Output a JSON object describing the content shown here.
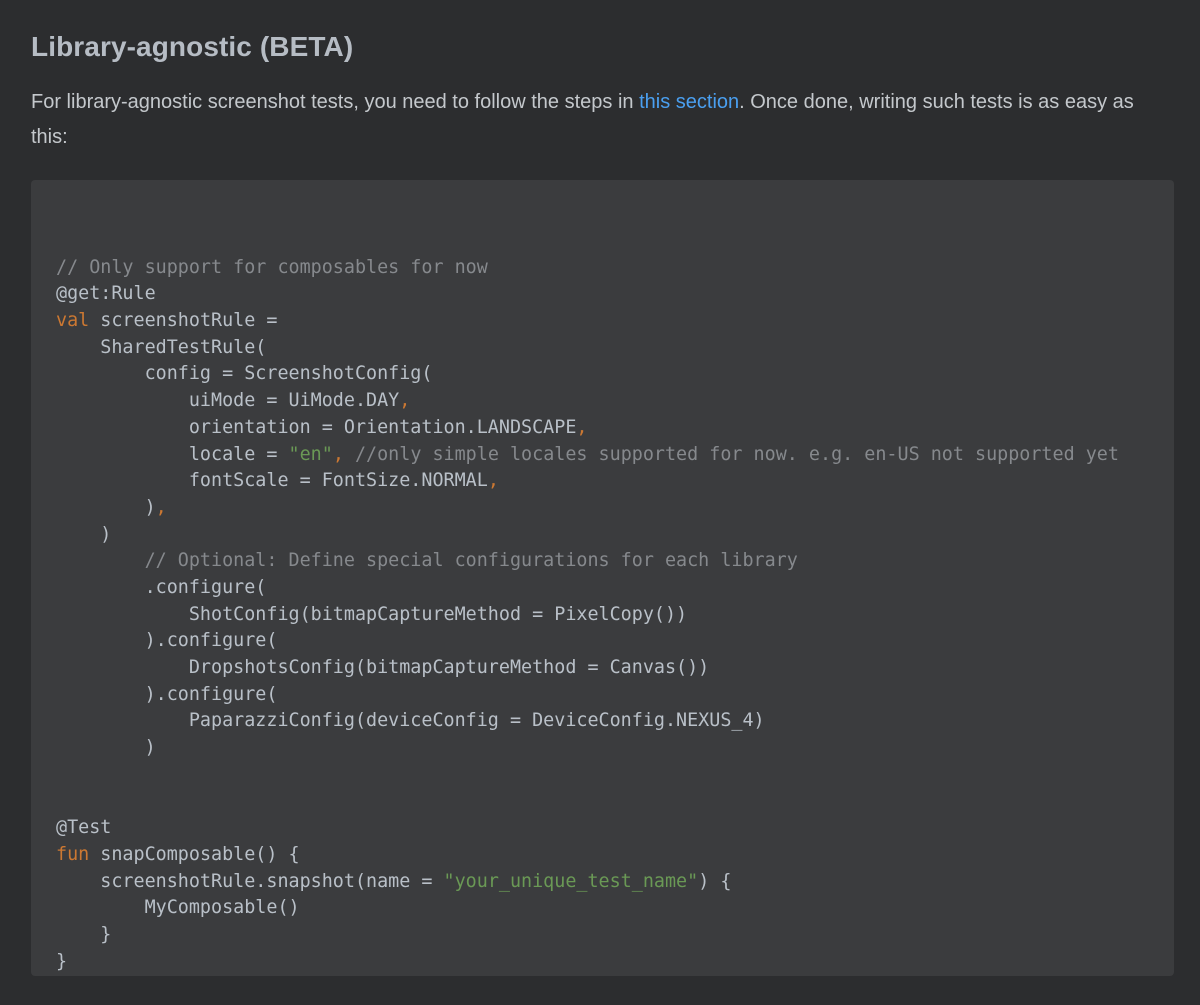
{
  "heading": "Library-agnostic (BETA)",
  "intro": {
    "before": "For library-agnostic screenshot tests, you need to follow the steps in ",
    "link": "this section",
    "after": ". Once done, writing such tests is as easy as this:"
  },
  "colors": {
    "background": "#2c2d2f",
    "code_background": "#3b3c3e",
    "link": "#4a9ff0",
    "keyword": "#cc7832",
    "string": "#6a9955",
    "comment": "#86898d",
    "text": "#b9c0c8"
  },
  "code": {
    "language": "kotlin",
    "lines": [
      [],
      [
        {
          "t": "cmt",
          "v": "// Only support for composables for now"
        }
      ],
      [
        {
          "t": "plain",
          "v": "@get:Rule"
        }
      ],
      [
        {
          "t": "kw",
          "v": "val"
        },
        {
          "t": "plain",
          "v": " screenshotRule ="
        }
      ],
      [
        {
          "t": "plain",
          "v": "    SharedTestRule("
        }
      ],
      [
        {
          "t": "plain",
          "v": "        config = ScreenshotConfig("
        }
      ],
      [
        {
          "t": "plain",
          "v": "            uiMode = UiMode.DAY"
        },
        {
          "t": "punct",
          "v": ","
        }
      ],
      [
        {
          "t": "plain",
          "v": "            orientation = Orientation.LANDSCAPE"
        },
        {
          "t": "punct",
          "v": ","
        }
      ],
      [
        {
          "t": "plain",
          "v": "            locale = "
        },
        {
          "t": "str",
          "v": "\"en\""
        },
        {
          "t": "punct",
          "v": ","
        },
        {
          "t": "cmt",
          "v": " //only simple locales supported for now. e.g. en-US not supported yet"
        }
      ],
      [
        {
          "t": "plain",
          "v": "            fontScale = FontSize.NORMAL"
        },
        {
          "t": "punct",
          "v": ","
        }
      ],
      [
        {
          "t": "plain",
          "v": "        )"
        },
        {
          "t": "punct",
          "v": ","
        }
      ],
      [
        {
          "t": "plain",
          "v": "    )"
        }
      ],
      [
        {
          "t": "cmt",
          "v": "        // Optional: Define special configurations for each library"
        }
      ],
      [
        {
          "t": "plain",
          "v": "        .configure("
        }
      ],
      [
        {
          "t": "plain",
          "v": "            ShotConfig(bitmapCaptureMethod = PixelCopy())"
        }
      ],
      [
        {
          "t": "plain",
          "v": "        ).configure("
        }
      ],
      [
        {
          "t": "plain",
          "v": "            DropshotsConfig(bitmapCaptureMethod = Canvas())"
        }
      ],
      [
        {
          "t": "plain",
          "v": "        ).configure("
        }
      ],
      [
        {
          "t": "plain",
          "v": "            PaparazziConfig(deviceConfig = DeviceConfig.NEXUS_4)"
        }
      ],
      [
        {
          "t": "plain",
          "v": "        )"
        }
      ],
      [],
      [],
      [
        {
          "t": "plain",
          "v": "@Test"
        }
      ],
      [
        {
          "t": "kw",
          "v": "fun"
        },
        {
          "t": "plain",
          "v": " snapComposable() {"
        }
      ],
      [
        {
          "t": "plain",
          "v": "    screenshotRule.snapshot(name = "
        },
        {
          "t": "str",
          "v": "\"your_unique_test_name\""
        },
        {
          "t": "plain",
          "v": ") {"
        }
      ],
      [
        {
          "t": "plain",
          "v": "        MyComposable()"
        }
      ],
      [
        {
          "t": "plain",
          "v": "    }"
        }
      ],
      [
        {
          "t": "plain",
          "v": "}"
        }
      ]
    ]
  }
}
